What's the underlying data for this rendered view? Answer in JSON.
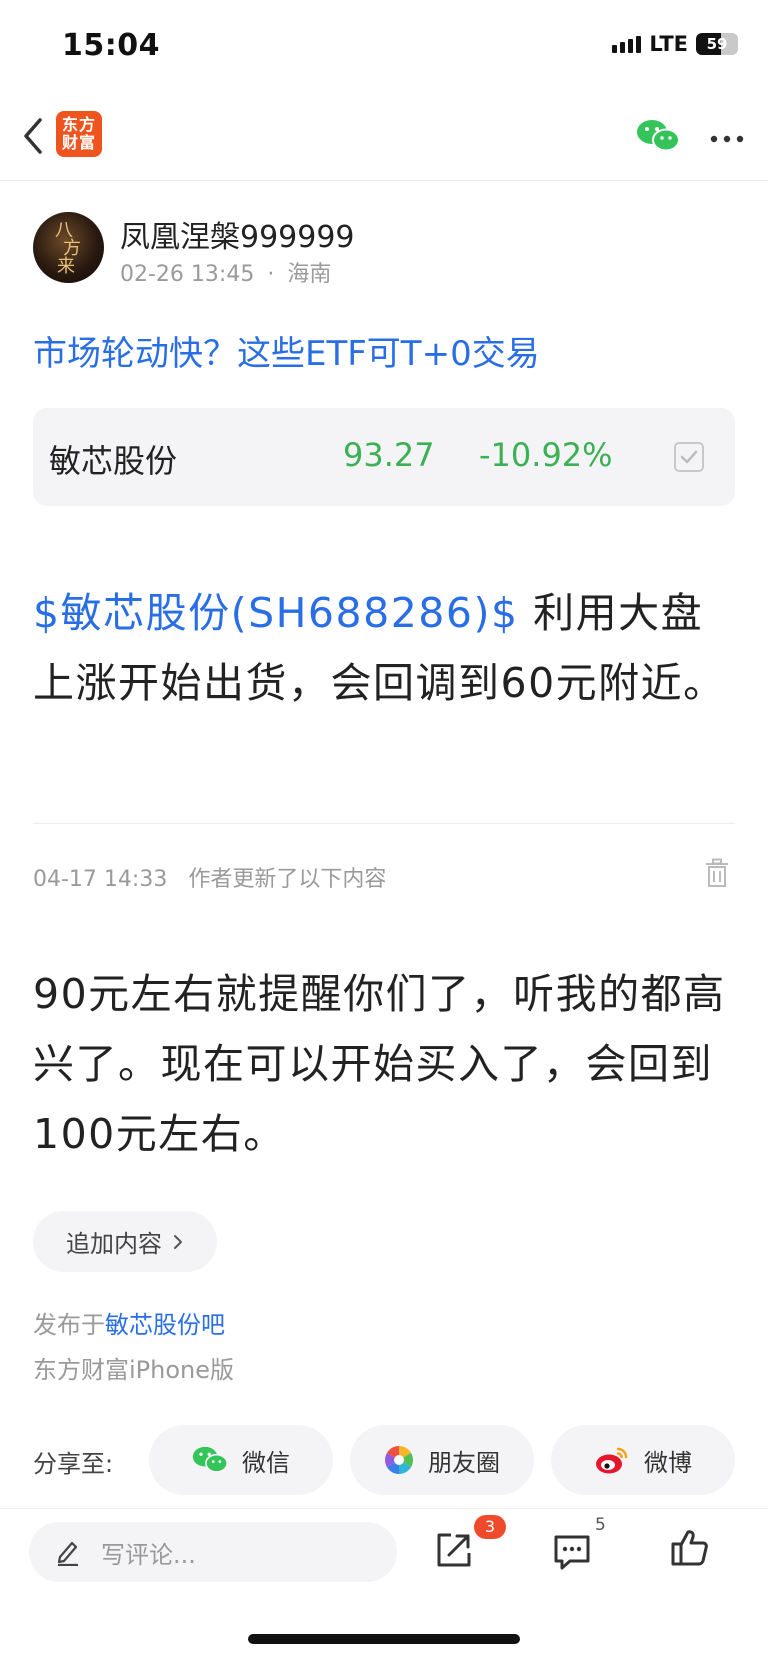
{
  "status_bar": {
    "time": "15:04",
    "network": "LTE",
    "battery": "59"
  },
  "nav": {
    "logo_line1": "东方",
    "logo_line2": "财富"
  },
  "author": {
    "name": "凤凰涅槃999999",
    "date": "02-26 13:45",
    "separator": "·",
    "location": "海南"
  },
  "ad_link": "市场轮动快？这些ETF可T+0交易",
  "stock": {
    "name": "敏芯股份",
    "price": "93.27",
    "change": "-10.92%",
    "color": "#3cb054"
  },
  "post": {
    "stock_tag": "$敏芯股份(SH688286)$",
    "text": "  利用大盘上涨开始出货，会回调到60元附近。"
  },
  "update": {
    "time": "04-17 14:33",
    "label": "作者更新了以下内容",
    "text": "90元左右就提醒你们了，听我的都高兴了。现在可以开始买入了，会回到100元左右。"
  },
  "append_button": {
    "label": "追加内容",
    "icon": "chevron-right-icon"
  },
  "source": {
    "prefix": "发布于",
    "forum": "敏芯股份吧",
    "client": "东方财富iPhone版"
  },
  "share": {
    "label": "分享至:",
    "targets": [
      {
        "label": "微信",
        "icon": "wechat-icon"
      },
      {
        "label": "朋友圈",
        "icon": "moments-icon"
      },
      {
        "label": "微博",
        "icon": "weibo-icon"
      }
    ]
  },
  "bottom_bar": {
    "comment_placeholder": "写评论...",
    "share_badge": "3",
    "comment_count": "5"
  },
  "colors": {
    "accent_blue": "#2a6ee6",
    "down_green": "#3cb054",
    "brand_orange": "#f0541e",
    "badge_red": "#f04a2c"
  }
}
